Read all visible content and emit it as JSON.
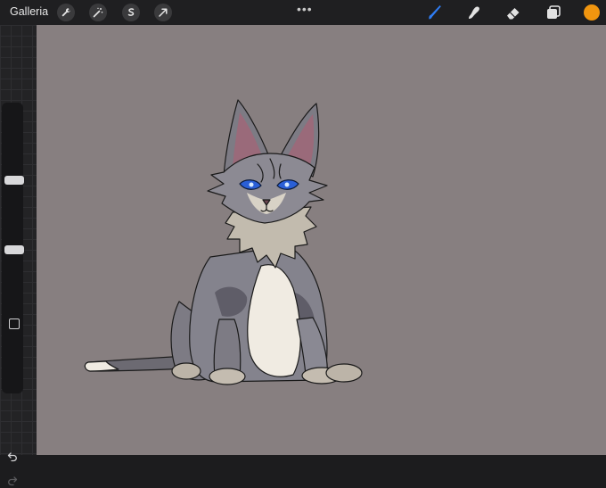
{
  "topbar": {
    "gallery_label": "Galleria",
    "more_dots": "•••",
    "left_tools": [
      "wrench-icon",
      "magic-wand-icon",
      "selection-icon",
      "transform-arrow-icon"
    ],
    "right_tools": [
      "brush-icon",
      "smudge-icon",
      "eraser-icon",
      "layers-icon"
    ],
    "current_color": "#f0950f"
  },
  "sidebar": {
    "controls": [
      "brush-size-slider",
      "modify-button",
      "opacity-slider",
      "undo-button",
      "redo-button"
    ]
  },
  "canvas": {
    "background": "#877f80",
    "subject": "drawing-cat"
  },
  "colors": {
    "accent_brush": "#2f7df4",
    "toolbar_bg": "#1f1f21",
    "canvas_bg": "#877f80"
  }
}
